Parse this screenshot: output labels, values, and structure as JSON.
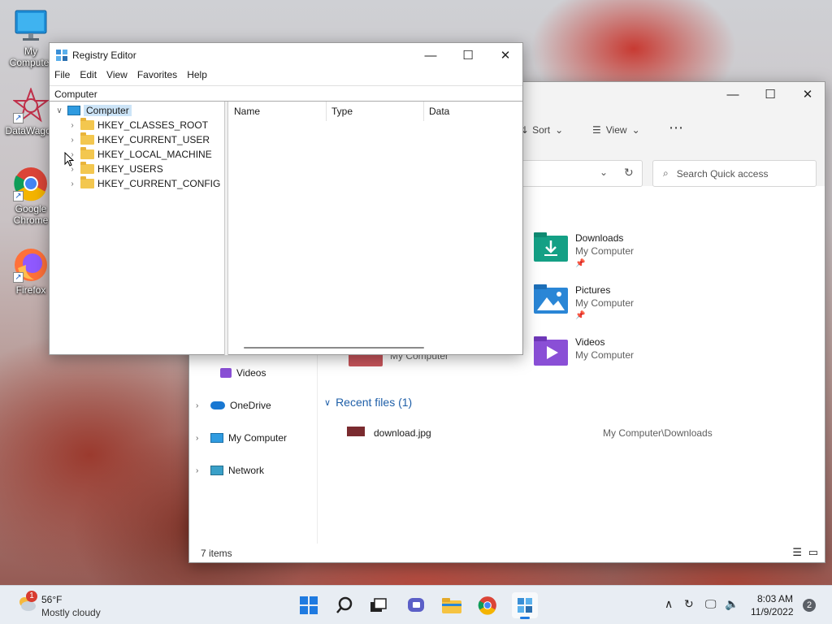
{
  "desktop": {
    "icons": [
      {
        "label": "My Computer"
      },
      {
        "label": "DataWagon"
      },
      {
        "label": "Google Chrome"
      },
      {
        "label": "Firefox"
      }
    ]
  },
  "regedit": {
    "title": "Registry Editor",
    "menu": [
      "File",
      "Edit",
      "View",
      "Favorites",
      "Help"
    ],
    "address": "Computer",
    "tree_root": "Computer",
    "hives": [
      "HKEY_CLASSES_ROOT",
      "HKEY_CURRENT_USER",
      "HKEY_LOCAL_MACHINE",
      "HKEY_USERS",
      "HKEY_CURRENT_CONFIG"
    ],
    "columns": [
      "Name",
      "Type",
      "Data"
    ]
  },
  "explorer": {
    "sort_label": "Sort",
    "view_label": "View",
    "search_placeholder": "Search Quick access",
    "quick_access": [
      {
        "name": "Downloads",
        "location": "My Computer"
      },
      {
        "name": "Pictures",
        "location": "My Computer"
      },
      {
        "name": "Videos",
        "location": "My Computer"
      }
    ],
    "partial_item_location": "My Computer",
    "nav": {
      "videos": "Videos",
      "onedrive": "OneDrive",
      "mycomputer": "My Computer",
      "network": "Network"
    },
    "recent_header": "Recent files (1)",
    "recent_files": [
      {
        "name": "download.jpg",
        "path": "My Computer\\Downloads"
      }
    ],
    "status": "7 items"
  },
  "taskbar": {
    "weather_temp": "56°F",
    "weather_desc": "Mostly cloudy",
    "weather_badge": "1",
    "time": "8:03 AM",
    "date": "11/9/2022",
    "notification_count": "2"
  }
}
